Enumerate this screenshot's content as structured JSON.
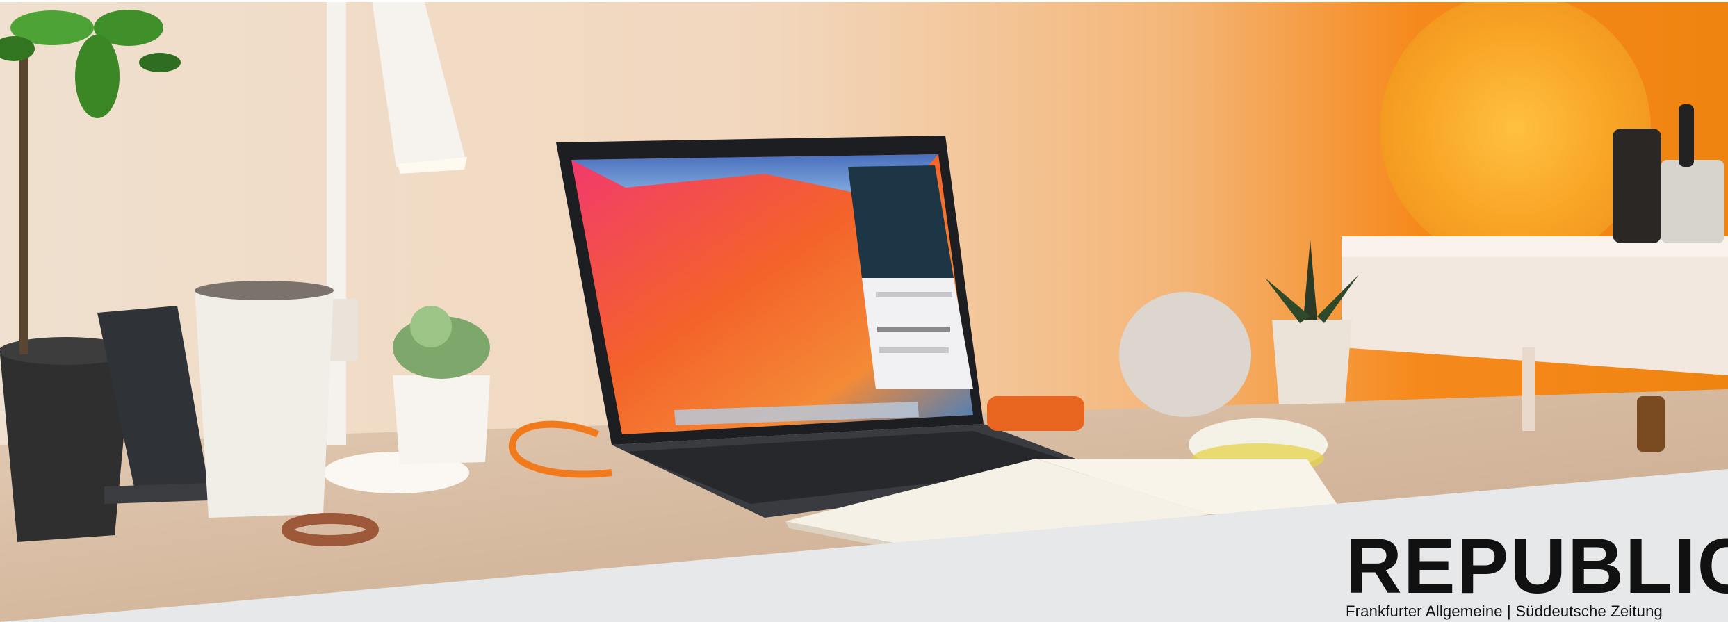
{
  "banner": {
    "brand": "REPUBLIC",
    "subline": "Frankfurter Allgemeine | Süddeutsche Zeitung"
  },
  "scene": {
    "description_icons": [
      "plant-icon",
      "desk-lamp-icon",
      "laptop-icon",
      "moon-lamp-icon",
      "smart-speaker-icon",
      "mouse-icon",
      "book-icon",
      "cup-icon",
      "bead-bracelet-icon",
      "succulent-icon"
    ],
    "colors": {
      "wall_warm": "#f1d6bd",
      "wall_orange": "#f58a1f",
      "desk": "#dcc4ab",
      "footer_band": "#e6e8e9",
      "brand_text": "#111111"
    }
  }
}
